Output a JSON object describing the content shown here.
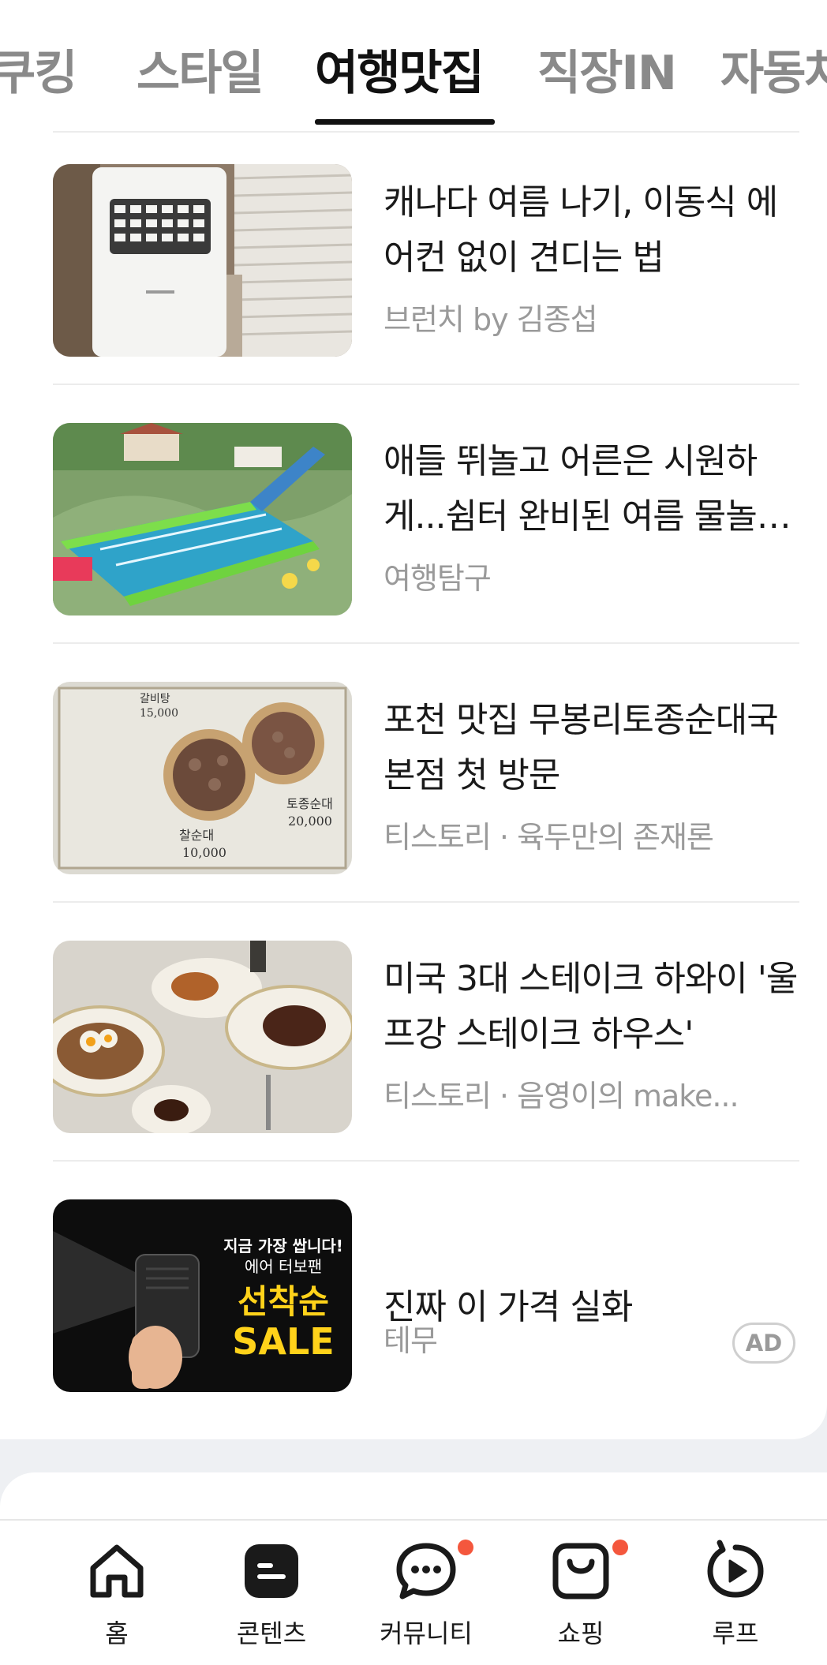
{
  "tabs": [
    {
      "label": "쿠킹",
      "active": false
    },
    {
      "label": "스타일",
      "active": false
    },
    {
      "label": "여행맛집",
      "active": true
    },
    {
      "label": "직장IN",
      "active": false
    },
    {
      "label": "자동차",
      "active": false
    }
  ],
  "articles": [
    {
      "title": "캐나다 여름 나기, 이동식 에어컨 없이 견디는 법",
      "source": "브런치 by 김종섭",
      "thumb": "air-conditioner-photo"
    },
    {
      "title": "애들 뛰놀고 어른은 시원하게...쉼터 완비된 여름 물놀이장",
      "source": "여행탐구",
      "thumb": "water-park-photo"
    },
    {
      "title": "포천 맛집 무봉리토종순대국 본점 첫 방문",
      "source": "티스토리 · 육두만의 존재론",
      "thumb": "sundae-menu-photo"
    },
    {
      "title": "미국 3대 스테이크 하와이 '울프강 스테이크 하우스'",
      "source": "티스토리 · 음영이의 make...",
      "thumb": "steak-dinner-photo"
    }
  ],
  "ad": {
    "title": "진짜 이 가격 실화",
    "source": "테무",
    "badge": "AD",
    "image_text_1": "지금 가장 쌉니다!",
    "image_text_2": "에어 터보팬",
    "image_text_3": "선착순",
    "image_text_4": "SALE"
  },
  "menu_prices": {
    "a": "15,000",
    "b": "20,000",
    "c": "10,000",
    "label_a": "갈비탕",
    "label_b": "토종순대",
    "label_c": "찰순대"
  },
  "bottom_nav": [
    {
      "label": "홈",
      "icon": "home-icon",
      "dot": false
    },
    {
      "label": "콘텐츠",
      "icon": "contents-icon",
      "dot": false
    },
    {
      "label": "커뮤니티",
      "icon": "chat-bubble-icon",
      "dot": true
    },
    {
      "label": "쇼핑",
      "icon": "shopping-bag-icon",
      "dot": true
    },
    {
      "label": "루프",
      "icon": "loop-play-icon",
      "dot": false
    }
  ],
  "colors": {
    "accent_dot": "#f4573d",
    "active_tab": "#111111",
    "inactive_tab": "#8a8a8a"
  }
}
